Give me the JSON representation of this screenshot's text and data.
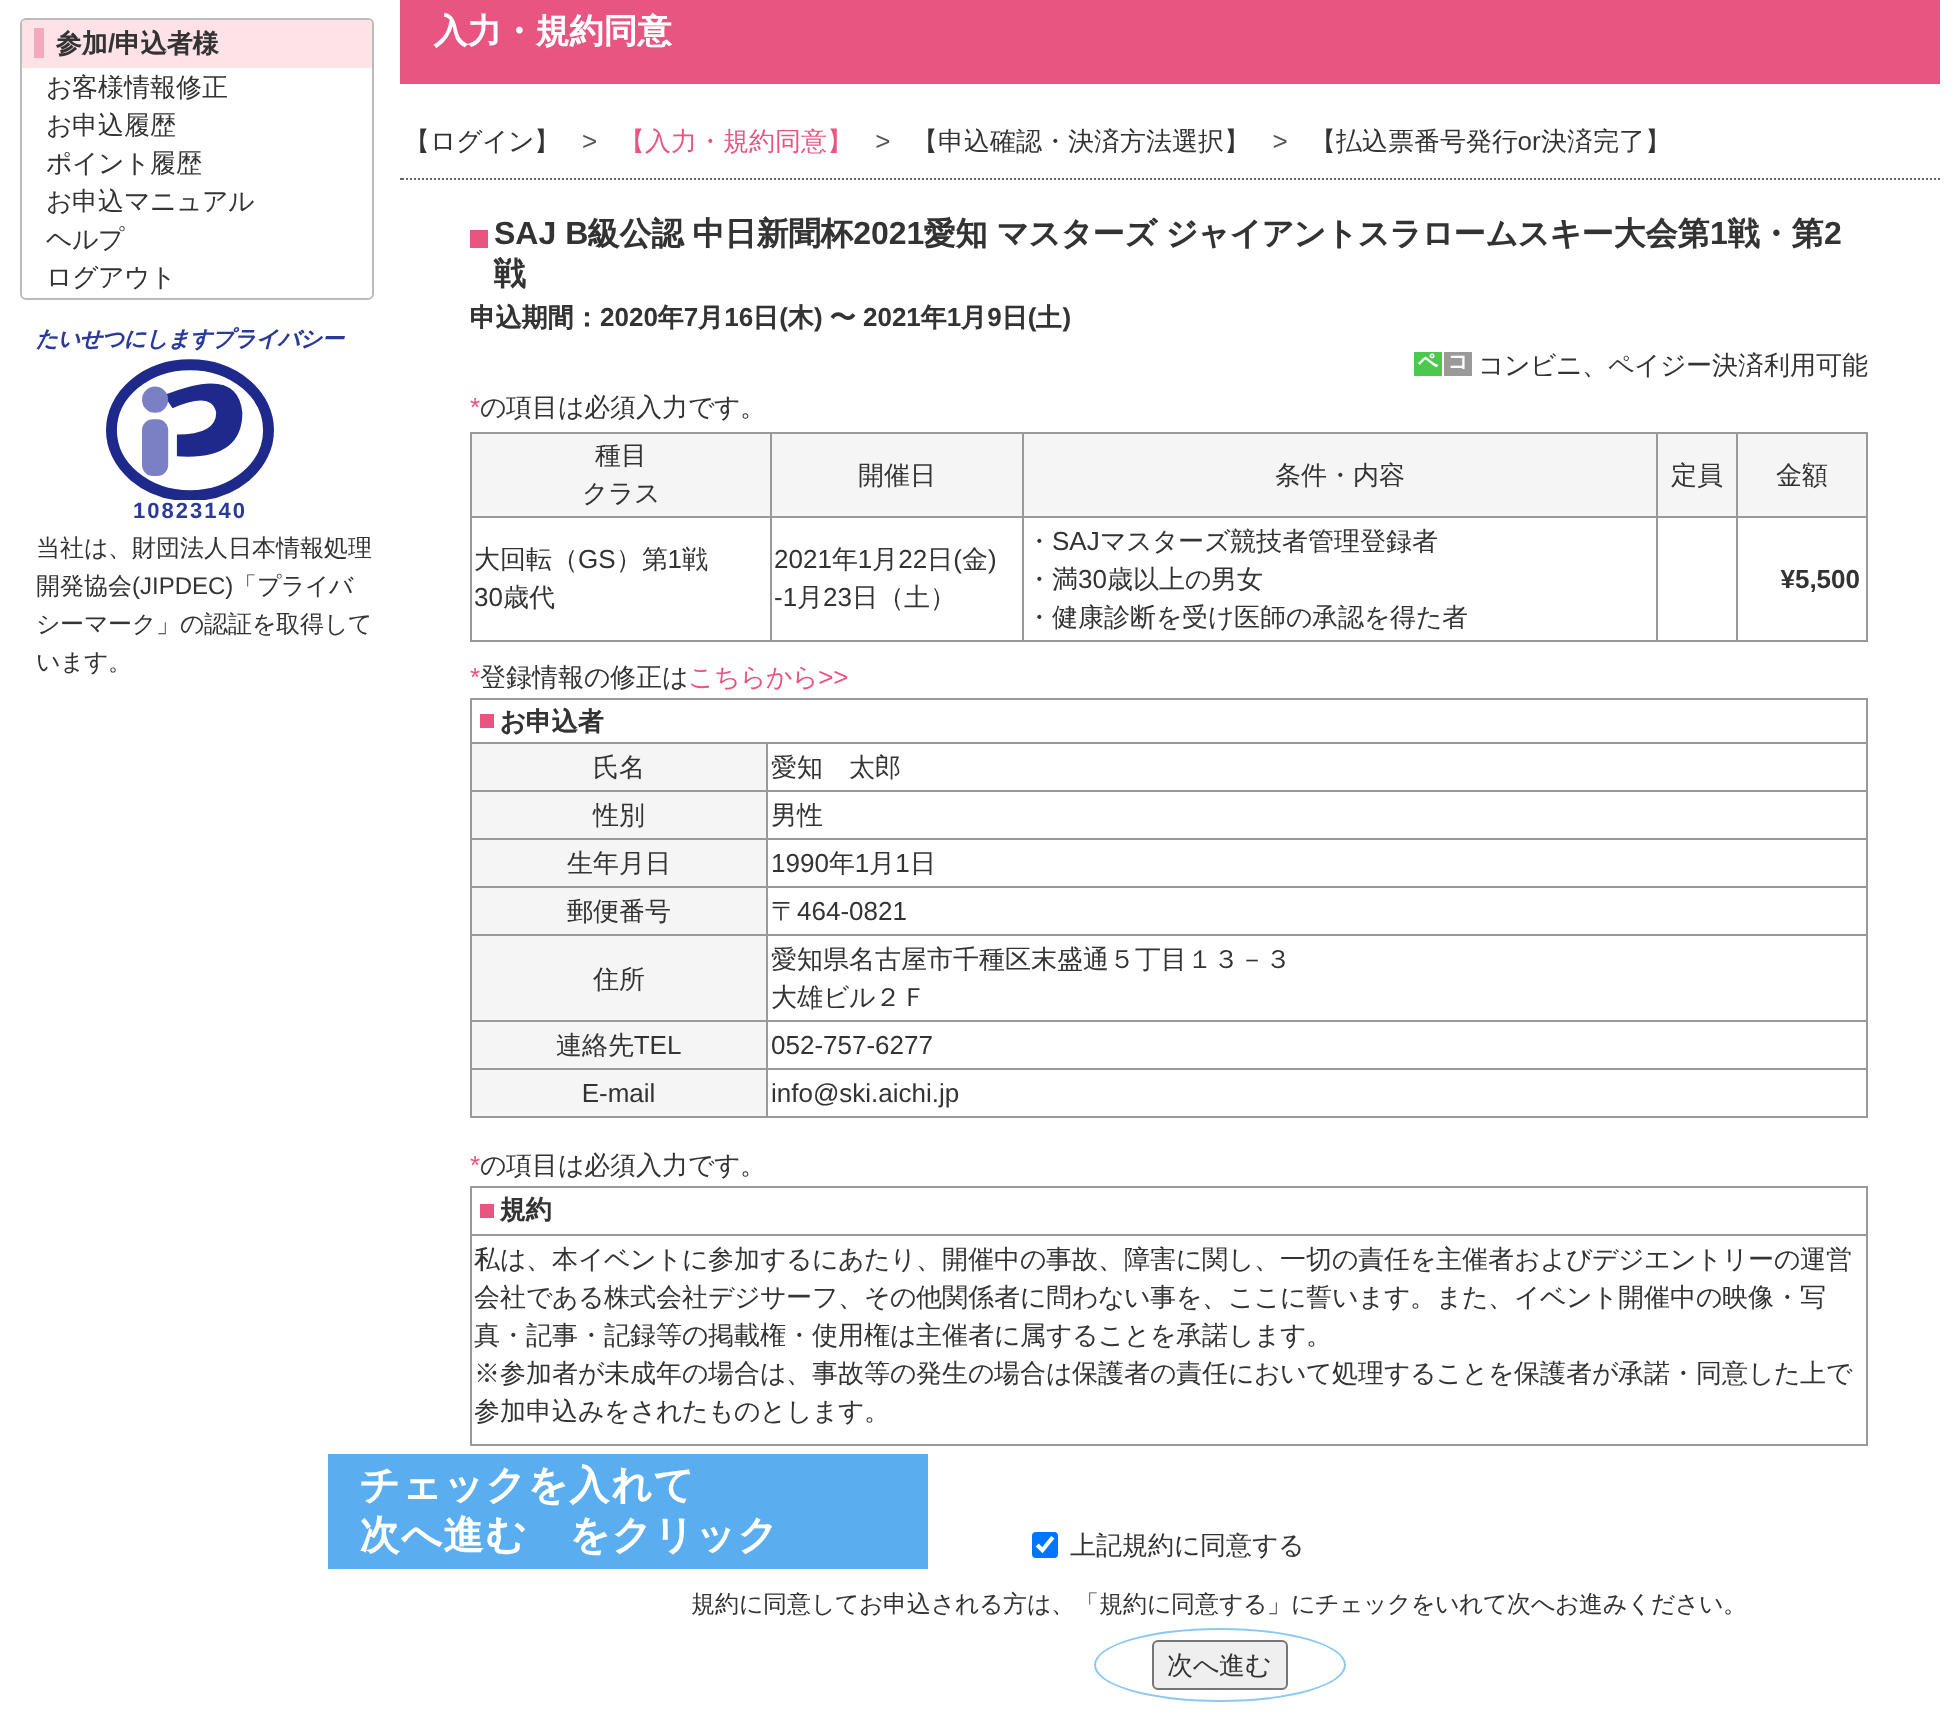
{
  "sidebar": {
    "heading": "参加/申込者様",
    "items": [
      "お客様情報修正",
      "お申込履歴",
      "ポイント履歴",
      "お申込マニュアル",
      "ヘルプ",
      "ログアウト"
    ]
  },
  "privacy_mark": {
    "arc_text_1": "たいせつにします",
    "arc_text_2": "プライバシー",
    "number": "10823140",
    "caption": "当社は、財団法人日本情報処理開発協会(JIPDEC)「プライバシーマーク」の認証を取得しています。"
  },
  "header": {
    "title": "入力・規約同意"
  },
  "breadcrumb": [
    {
      "kind": "step",
      "label": "【ログイン】",
      "selected": false
    },
    {
      "kind": "separator",
      "label": ">"
    },
    {
      "kind": "step",
      "label": "【入力・規約同意】",
      "selected": true
    },
    {
      "kind": "separator",
      "label": ">"
    },
    {
      "kind": "step",
      "label": "【申込確認・決済方法選択】",
      "selected": false
    },
    {
      "kind": "separator",
      "label": ">"
    },
    {
      "kind": "step",
      "label": "【払込票番号発行or決済完了】",
      "selected": false
    }
  ],
  "event": {
    "title": "SAJ B級公認 中日新聞杯2021愛知 マスターズ ジャイアントスラロームスキー大会第1戦・第2戦",
    "period": "申込期間：2020年7月16日(木) 〜 2021年1月9日(土)",
    "payment_badges": [
      "ペ",
      "コ"
    ],
    "payment_note": "コンビニ、ペイジー決済利用可能"
  },
  "required_note": {
    "mark": "*",
    "text": "の項目は必須入力です。"
  },
  "fee_table": {
    "columns": [
      [
        "種目",
        "クラス"
      ],
      [
        "開催日"
      ],
      [
        "条件・内容"
      ],
      [
        "定員"
      ],
      [
        "金額"
      ]
    ],
    "rows": [
      {
        "event": [
          "大回転（GS）第1戦",
          "30歳代"
        ],
        "date": [
          "2021年1月22日(金)",
          "-1月23日（土）"
        ],
        "conditions": [
          "・SAJマスターズ競技者管理登録者",
          "・満30歳以上の男女",
          "・健康診断を受け医師の承認を得た者"
        ],
        "price": "¥5,500"
      }
    ]
  },
  "edit_note": {
    "mark": "*",
    "text": "登録情報の修正は",
    "link": "こちらから>>"
  },
  "applicant": {
    "heading": "お申込者",
    "rows": [
      {
        "label": "氏名",
        "value": [
          "愛知　太郎"
        ]
      },
      {
        "label": "性別",
        "value": [
          "男性"
        ]
      },
      {
        "label": "生年月日",
        "value": [
          "1990年1月1日"
        ]
      },
      {
        "label": "郵便番号",
        "value": [
          "〒464-0821"
        ]
      },
      {
        "label": "住所",
        "value": [
          "愛知県名古屋市千種区末盛通５丁目１３－３",
          "大雄ビル２Ｆ"
        ]
      },
      {
        "label": "連絡先TEL",
        "value": [
          "052-757-6277"
        ]
      },
      {
        "label": "E-mail",
        "value": [
          "info@ski.aichi.jp"
        ]
      }
    ]
  },
  "terms_required_note": {
    "mark": "*",
    "text": "の項目は必須入力です。"
  },
  "terms": {
    "heading": "規約",
    "paragraphs": [
      "私は、本イベントに参加するにあたり、開催中の事故、障害に関し、一切の責任を主催者およびデジエントリーの運営会社である株式会社デジサーフ、その他関係者に問わない事を、ここに誓います。また、イベント開催中の映像・写真・記事・記録等の掲載権・使用権は主催者に属することを承諾します。",
      "※参加者が未成年の場合は、事故等の発生の場合は保護者の責任において処理することを保護者が承諾・同意した上で参加申込みをされたものとします。"
    ]
  },
  "agree": {
    "label": "上記規約に同意する",
    "checked": true
  },
  "instruction": "規約に同意してお申込される方は、「規約に同意する」にチェックをいれて次へお進みください。",
  "next_button": {
    "label": "次へ進む"
  },
  "callout": {
    "lines": [
      "チェックを入れて",
      "次へ進む　をクリック"
    ]
  }
}
